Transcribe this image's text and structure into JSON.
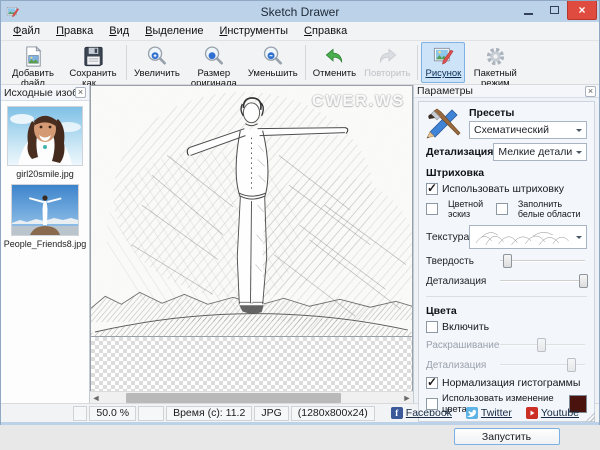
{
  "window": {
    "title": "Sketch Drawer"
  },
  "menu": {
    "items": [
      {
        "label": "Файл"
      },
      {
        "label": "Правка"
      },
      {
        "label": "Вид"
      },
      {
        "label": "Выделение"
      },
      {
        "label": "Инструменты"
      },
      {
        "label": "Справка"
      }
    ]
  },
  "toolbar": {
    "buttons": [
      {
        "label": "Добавить файл"
      },
      {
        "label": "Сохранить как..."
      },
      {
        "label": "Увеличить"
      },
      {
        "label": "Размер оригинала"
      },
      {
        "label": "Уменьшить"
      },
      {
        "label": "Отменить"
      },
      {
        "label": "Повторить"
      },
      {
        "label": "Рисунок"
      },
      {
        "label": "Пакетный режим"
      }
    ]
  },
  "source_panel": {
    "title": "Исходные изоб...",
    "items": [
      {
        "filename": "girl20smile.jpg"
      },
      {
        "filename": "People_Friends8.jpg"
      }
    ]
  },
  "canvas": {
    "watermark": "CWER.WS"
  },
  "params": {
    "title": "Параметры",
    "presets_label": "Пресеты",
    "preset_value": "Схематический",
    "detail_label": "Детализация",
    "detail_value": "Мелкие детали",
    "hatching": {
      "title": "Штриховка",
      "use_hatching": {
        "label": "Использовать штриховку",
        "checked": true
      },
      "color_sketch": {
        "label": "Цветной эскиз",
        "checked": false
      },
      "fill_white": {
        "label": "Заполнить белые области",
        "checked": false
      },
      "texture_label": "Текстура",
      "hardness": {
        "label": "Твердость",
        "percent": 10
      },
      "detail": {
        "label": "Детализация",
        "percent": 96
      }
    },
    "colors": {
      "title": "Цвета",
      "enable": {
        "label": "Включить",
        "checked": false
      },
      "colorize": {
        "label": "Раскрашивание",
        "percent": 48
      },
      "detail": {
        "label": "Детализация",
        "percent": 82
      },
      "histogram": {
        "label": "Нормализация гистограммы",
        "checked": true
      },
      "color_change": {
        "label": "Использовать изменение цвета",
        "checked": false,
        "swatch_color": "#4a130d"
      }
    },
    "run_label": "Запустить"
  },
  "status": {
    "zoom": "50.0 %",
    "time": "Время (с): 11.2",
    "format": "JPG",
    "dimensions": "(1280x800x24)",
    "links": [
      {
        "label": "Facebook"
      },
      {
        "label": "Twitter"
      },
      {
        "label": "Youtube"
      }
    ]
  }
}
